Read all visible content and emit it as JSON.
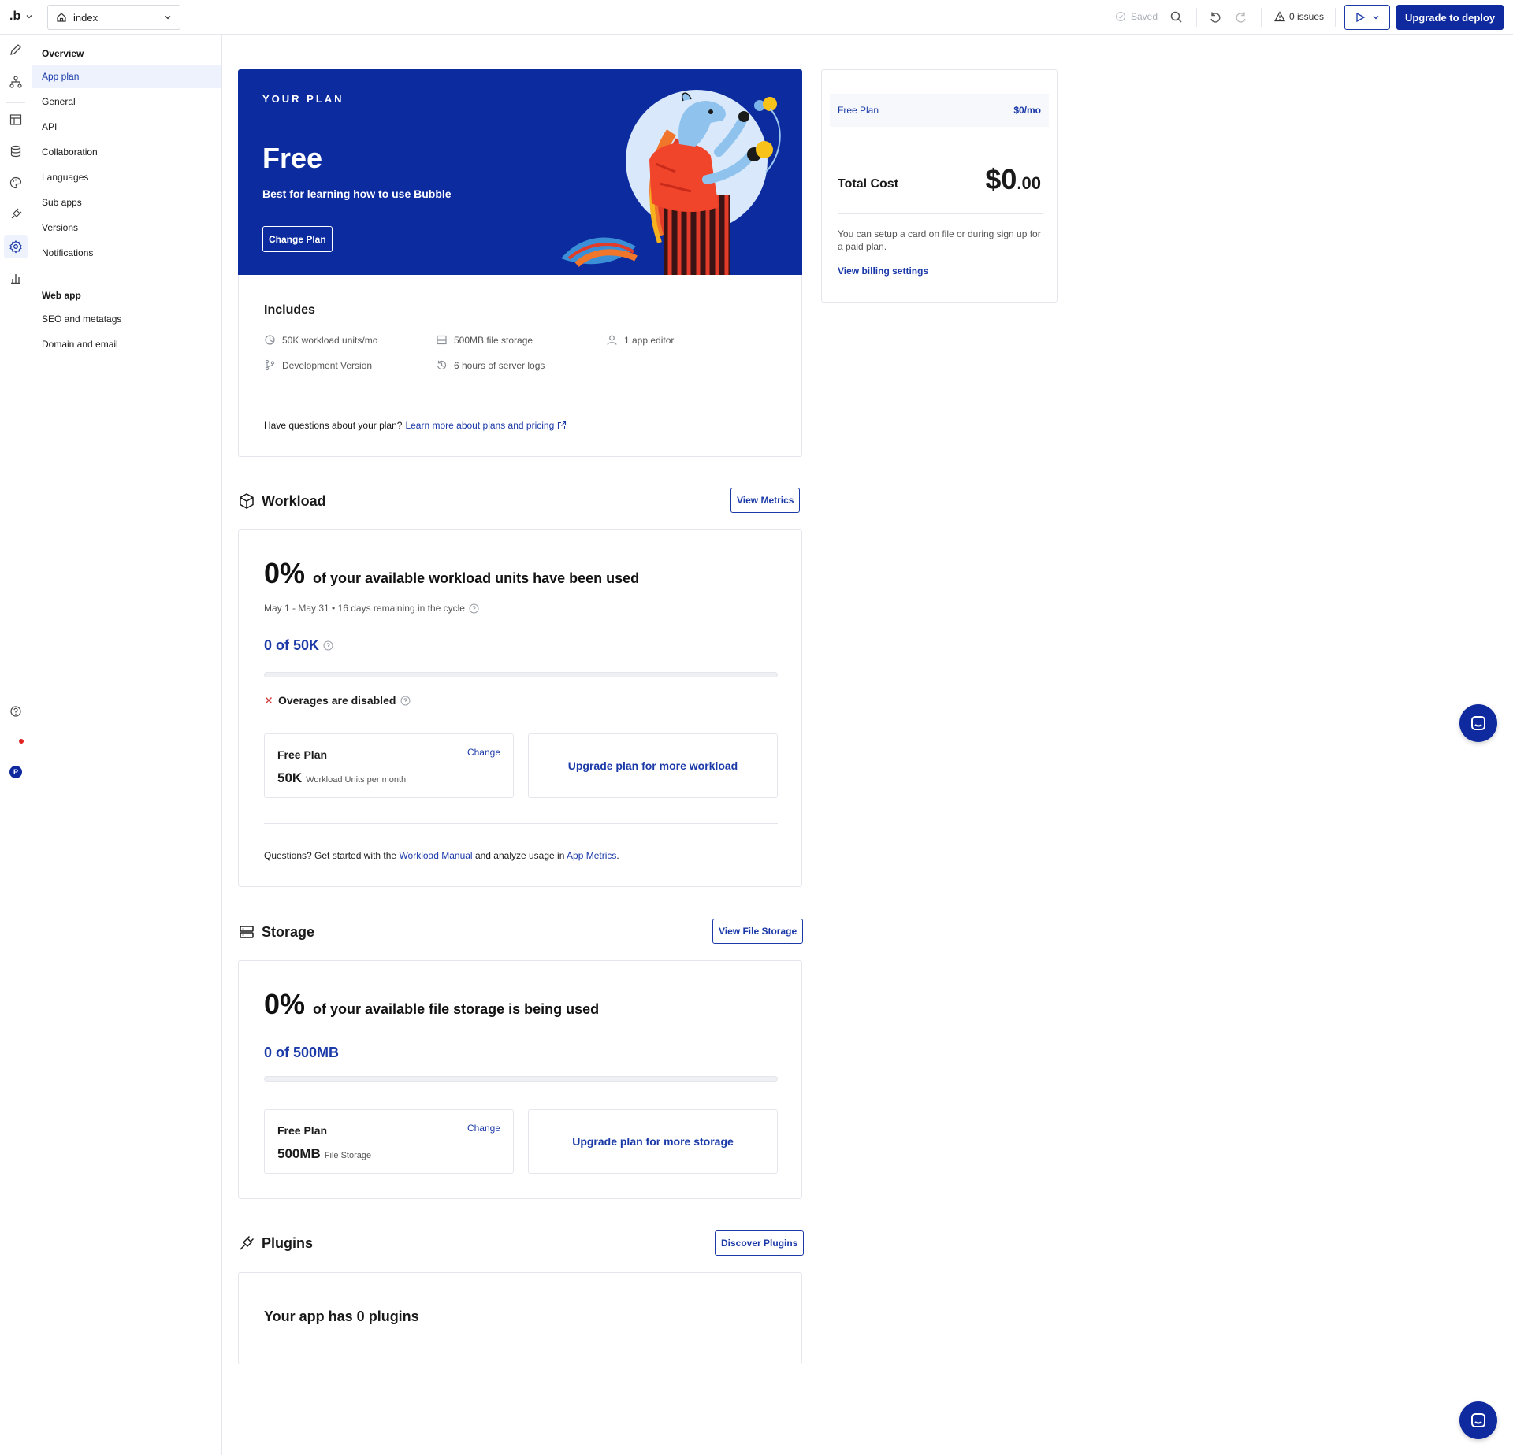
{
  "topbar": {
    "logo": ".b",
    "page_selector": {
      "value": "index"
    },
    "saved_label": "Saved",
    "issues_label": "0 issues",
    "deploy_label": "Upgrade to deploy",
    "icons": [
      "saved-check-icon",
      "search-icon",
      "undo-icon",
      "redo-icon",
      "warning-icon",
      "play-icon",
      "chevron-down-icon"
    ]
  },
  "rail": {
    "items": [
      "design-icon",
      "workflow-icon",
      "data-icon",
      "styles-icon",
      "plugins-icon",
      "settings-icon",
      "logs-icon"
    ],
    "active": "settings-icon",
    "avatar_initial": "P"
  },
  "sidebar": {
    "overview_heading": "Overview",
    "items": [
      "App plan",
      "General",
      "API",
      "Collaboration",
      "Languages",
      "Sub apps",
      "Versions",
      "Notifications"
    ],
    "webapp_heading": "Web app",
    "webapp_items": [
      "SEO and metatags",
      "Domain and email"
    ],
    "active": "App plan"
  },
  "plan": {
    "eyebrow": "YOUR PLAN",
    "name": "Free",
    "tagline": "Best for learning how to use Bubble",
    "change_label": "Change Plan",
    "includes_title": "Includes",
    "includes": [
      {
        "icon": "workload-icon",
        "text": "50K workload units/mo"
      },
      {
        "icon": "storage-icon",
        "text": "500MB file storage"
      },
      {
        "icon": "user-icon",
        "text": "1 app editor"
      },
      {
        "icon": "branch-icon",
        "text": "Development Version"
      },
      {
        "icon": "history-icon",
        "text": "6 hours of server logs"
      }
    ],
    "question_text": "Have questions about your plan?",
    "question_link": "Learn more about plans and pricing"
  },
  "workload": {
    "title": "Workload",
    "button": "View Metrics",
    "percent": "0%",
    "percent_text": "of your available workload units have been used",
    "cycle": "May 1 - May 31 • 16 days remaining in the cycle",
    "usage": "0 of 50K",
    "usage_fraction": 0,
    "overage": "Overages are disabled",
    "plan_title": "Free Plan",
    "plan_change": "Change",
    "plan_amount": "50K",
    "plan_unit": "Workload Units per month",
    "upgrade": "Upgrade plan for more workload",
    "foot_prefix": "Questions? Get started with the",
    "foot_link1": "Workload Manual",
    "foot_mid": "and analyze usage in",
    "foot_link2": "App Metrics",
    "foot_suffix": "."
  },
  "storage": {
    "title": "Storage",
    "button": "View File Storage",
    "percent": "0%",
    "percent_text": "of your available file storage is being used",
    "usage": "0 of 500MB",
    "usage_fraction": 0,
    "plan_title": "Free Plan",
    "plan_change": "Change",
    "plan_amount": "500MB",
    "plan_unit": "File Storage",
    "upgrade": "Upgrade plan for more storage"
  },
  "plugins": {
    "title": "Plugins",
    "button": "Discover Plugins",
    "count_text": "Your app has 0 plugins"
  },
  "summary": {
    "line_label": "Free Plan",
    "line_price": "$0/mo",
    "total_label": "Total Cost",
    "total_big": "$0",
    "total_small": ".00",
    "note": "You can setup a card on file or during sign up for a paid plan.",
    "billing_link": "View billing settings"
  },
  "colors": {
    "brand": "#0f2a9e",
    "link": "#1b3aa8",
    "hero_bg": "#0c2b9e",
    "border": "#e4e6eb"
  }
}
